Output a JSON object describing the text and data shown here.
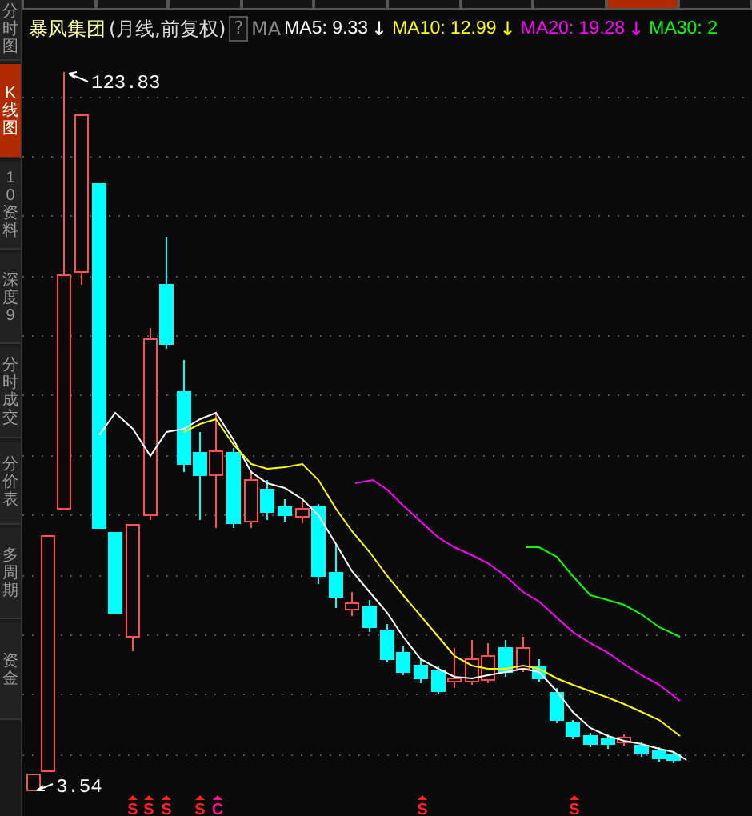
{
  "top_tabs": [
    {
      "selected": false
    },
    {
      "selected": false
    },
    {
      "selected": false
    },
    {
      "selected": false
    },
    {
      "selected": false
    },
    {
      "selected": false
    },
    {
      "selected": false
    },
    {
      "selected": false
    },
    {
      "selected": true
    },
    {
      "selected": false
    }
  ],
  "sidebar": {
    "items": [
      {
        "label": "分时图",
        "selected": false
      },
      {
        "label": "K线图",
        "selected": true
      },
      {
        "label": "10资料",
        "selected": false
      },
      {
        "label": "深度9",
        "selected": false
      },
      {
        "label": "分时成交",
        "selected": false
      },
      {
        "label": "分价表",
        "selected": false
      },
      {
        "label": "多周期",
        "selected": false
      },
      {
        "label": "资金",
        "selected": false
      }
    ]
  },
  "header": {
    "stock_name": "暴风集团",
    "period": "(月线,前复权)",
    "help": "?",
    "indicator": "MA",
    "ma_items": [
      {
        "label": "MA5: 9.33",
        "arrow": "↓",
        "color": "#ffffff"
      },
      {
        "label": "MA10: 12.99",
        "arrow": "↓",
        "color": "#ffff00"
      },
      {
        "label": "MA20: 19.28",
        "arrow": "↓",
        "color": "#ff00ff"
      },
      {
        "label": "MA30: 2",
        "color": "#00ff00"
      }
    ]
  },
  "chart": {
    "high_label": "123.83",
    "low_label": "3.54",
    "signals": [
      {
        "label": "S",
        "color": "#ff2020"
      },
      {
        "label": "S",
        "color": "#ff2020"
      },
      {
        "label": "S",
        "color": "#ff2020"
      },
      {
        "label": "S",
        "color": "#ff2020"
      },
      {
        "label": "C",
        "color": "#ff1090"
      },
      {
        "label": "S",
        "color": "#ff2020"
      },
      {
        "label": "S",
        "color": "#ff2020"
      }
    ]
  }
}
